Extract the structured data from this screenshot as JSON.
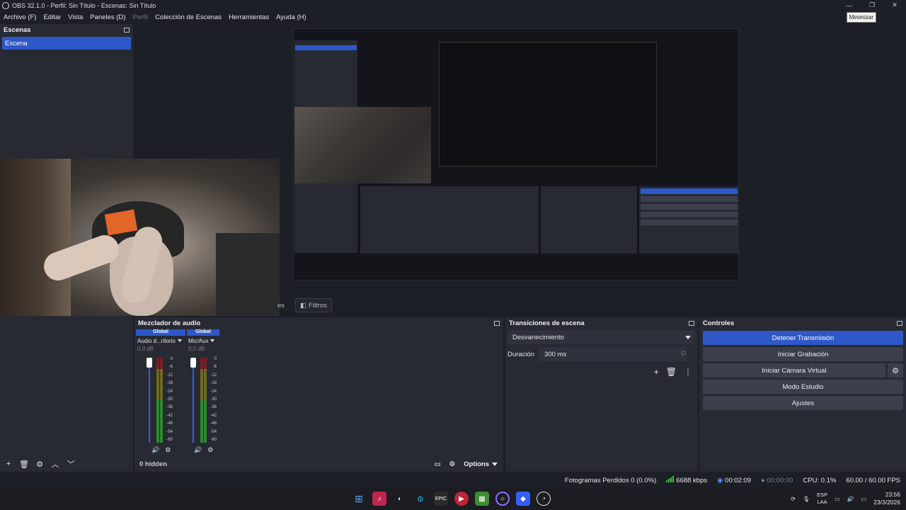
{
  "window": {
    "title": "OBS 32.1.0 - Perfil: Sin Título - Escenas: Sin Título",
    "tooltip": "Minimizar"
  },
  "menu": {
    "items": [
      {
        "label": "Archivo (F)",
        "disabled": false
      },
      {
        "label": "Editar",
        "disabled": false
      },
      {
        "label": "Vista",
        "disabled": false
      },
      {
        "label": "Paneles (D)",
        "disabled": false
      },
      {
        "label": "Perfil",
        "disabled": true
      },
      {
        "label": "Colección de Escenas",
        "disabled": false
      },
      {
        "label": "Herramientas",
        "disabled": false
      },
      {
        "label": "Ayuda (H)",
        "disabled": false
      }
    ]
  },
  "scenes": {
    "title": "Escenas",
    "items": [
      "Escena"
    ]
  },
  "sources_bar": {
    "partial_label": "es",
    "filters_label": "Filtros"
  },
  "mixer": {
    "title": "Mezclador de audio",
    "channels": [
      {
        "header": "Global",
        "name": "Audio d...ritorio",
        "db": "0.0 dB"
      },
      {
        "header": "Global",
        "name": "Mic/Aux",
        "db": "0.0 dB"
      }
    ],
    "scale": [
      "0",
      "-6",
      "-12",
      "-18",
      "-24",
      "-30",
      "-36",
      "-42",
      "-48",
      "-54",
      "-60"
    ],
    "hidden": "0 hidden",
    "options": "Options"
  },
  "transitions": {
    "title": "Transiciones de escena",
    "selected": "Desvanecimiento",
    "duration_label": "Duración",
    "duration_value": "300 ms"
  },
  "controls": {
    "title": "Controles",
    "stop_stream": "Detener Transmisión",
    "start_record": "Iniciar Grabación",
    "start_virtualcam": "Iniciar Cámara Virtual",
    "studio_mode": "Modo Estudio",
    "settings": "Ajustes"
  },
  "status": {
    "dropped": "Fotogramas Perdidos 0 (0.0%)",
    "bitrate": "6688 kbps",
    "stream_time": "00:02:09",
    "record_time": "00:00:00",
    "cpu": "CPU: 0.1%",
    "fps": "60.00 / 60.00 FPS"
  },
  "taskbar": {
    "lang_top": "ESP",
    "lang_bottom": "LAA",
    "time": "23:56",
    "date": "23/3/2026"
  },
  "colors": {
    "accent": "#2e58c8",
    "panel": "#272a33",
    "background": "#1d1f26"
  }
}
